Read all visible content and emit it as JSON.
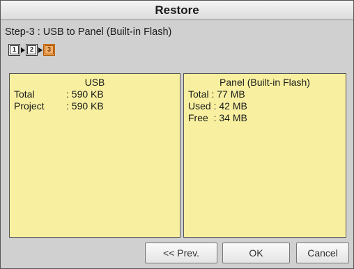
{
  "window": {
    "title": "Restore"
  },
  "step": {
    "title": "Step-3 : USB to Panel (Built-in Flash)",
    "indicators": [
      "1",
      "2",
      "3"
    ],
    "active_index": 3
  },
  "usb_panel": {
    "header": "USB",
    "rows": [
      {
        "label": "Total",
        "value": ": 590 KB"
      },
      {
        "label": "Project",
        "value": ": 590 KB"
      }
    ]
  },
  "flash_panel": {
    "header": "Panel (Built-in Flash)",
    "rows": [
      {
        "label": "Total",
        "value": " : 77 MB"
      },
      {
        "label": "Used",
        "value": " : 42 MB"
      },
      {
        "label": "Free",
        "value": "  : 34 MB"
      }
    ]
  },
  "buttons": {
    "prev": "<< Prev.",
    "ok": "OK",
    "cancel": "Cancel"
  },
  "colors": {
    "panel_bg": "#f8f0a0",
    "active_step": "#f2a35a",
    "window_bg": "#d0d0d0"
  }
}
